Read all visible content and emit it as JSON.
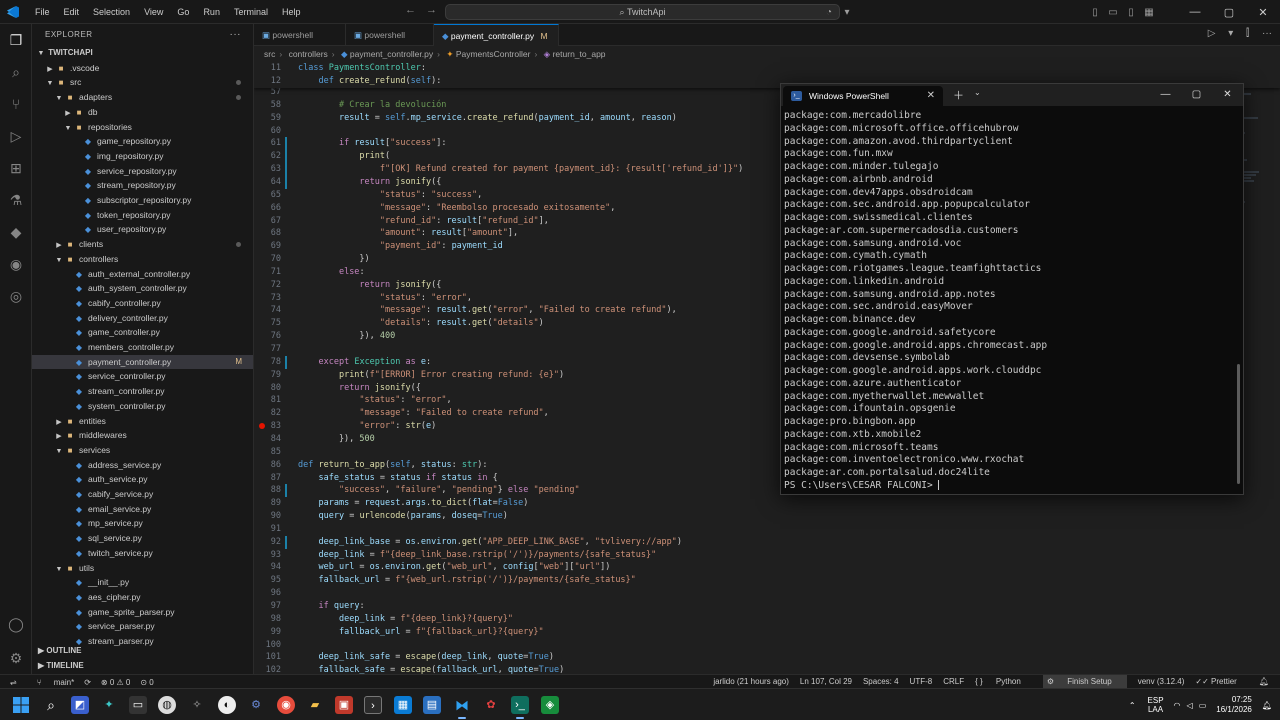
{
  "titlebar": {
    "menu": [
      "File",
      "Edit",
      "Selection",
      "View",
      "Go",
      "Run",
      "Terminal",
      "Help"
    ],
    "search": "TwitchApi"
  },
  "explorer": {
    "header": "EXPLORER",
    "root": "TWITCHAPI",
    "tree": [
      {
        "label": ".vscode",
        "depth": 1,
        "type": "folder",
        "open": false
      },
      {
        "label": "src",
        "depth": 1,
        "type": "folder",
        "open": true
      },
      {
        "label": "adapters",
        "depth": 2,
        "type": "folder",
        "open": true
      },
      {
        "label": "db",
        "depth": 3,
        "type": "folder",
        "open": false
      },
      {
        "label": "repositories",
        "depth": 3,
        "type": "folder",
        "open": true
      },
      {
        "label": "game_repository.py",
        "depth": 4,
        "type": "py"
      },
      {
        "label": "img_repository.py",
        "depth": 4,
        "type": "py"
      },
      {
        "label": "service_repository.py",
        "depth": 4,
        "type": "py"
      },
      {
        "label": "stream_repository.py",
        "depth": 4,
        "type": "py"
      },
      {
        "label": "subscriptor_repository.py",
        "depth": 4,
        "type": "py"
      },
      {
        "label": "token_repository.py",
        "depth": 4,
        "type": "py"
      },
      {
        "label": "user_repository.py",
        "depth": 4,
        "type": "py"
      },
      {
        "label": "clients",
        "depth": 2,
        "type": "folder",
        "open": false
      },
      {
        "label": "controllers",
        "depth": 2,
        "type": "folder",
        "open": true
      },
      {
        "label": "auth_external_controller.py",
        "depth": 3,
        "type": "py"
      },
      {
        "label": "auth_system_controller.py",
        "depth": 3,
        "type": "py"
      },
      {
        "label": "cabify_controller.py",
        "depth": 3,
        "type": "py"
      },
      {
        "label": "delivery_controller.py",
        "depth": 3,
        "type": "py"
      },
      {
        "label": "game_controller.py",
        "depth": 3,
        "type": "py"
      },
      {
        "label": "members_controller.py",
        "depth": 3,
        "type": "py"
      },
      {
        "label": "payment_controller.py",
        "depth": 3,
        "type": "py",
        "selected": true,
        "badge": "M"
      },
      {
        "label": "service_controller.py",
        "depth": 3,
        "type": "py"
      },
      {
        "label": "stream_controller.py",
        "depth": 3,
        "type": "py"
      },
      {
        "label": "system_controller.py",
        "depth": 3,
        "type": "py"
      },
      {
        "label": "entities",
        "depth": 2,
        "type": "folder",
        "open": false
      },
      {
        "label": "middlewares",
        "depth": 2,
        "type": "folder",
        "open": false
      },
      {
        "label": "services",
        "depth": 2,
        "type": "folder",
        "open": true
      },
      {
        "label": "address_service.py",
        "depth": 3,
        "type": "py"
      },
      {
        "label": "auth_service.py",
        "depth": 3,
        "type": "py"
      },
      {
        "label": "cabify_service.py",
        "depth": 3,
        "type": "py"
      },
      {
        "label": "email_service.py",
        "depth": 3,
        "type": "py"
      },
      {
        "label": "mp_service.py",
        "depth": 3,
        "type": "py"
      },
      {
        "label": "sql_service.py",
        "depth": 3,
        "type": "py"
      },
      {
        "label": "twitch_service.py",
        "depth": 3,
        "type": "py"
      },
      {
        "label": "utils",
        "depth": 2,
        "type": "folder",
        "open": true
      },
      {
        "label": "__init__.py",
        "depth": 3,
        "type": "py"
      },
      {
        "label": "aes_cipher.py",
        "depth": 3,
        "type": "py"
      },
      {
        "label": "game_sprite_parser.py",
        "depth": 3,
        "type": "py"
      },
      {
        "label": "service_parser.py",
        "depth": 3,
        "type": "py"
      },
      {
        "label": "stream_parser.py",
        "depth": 3,
        "type": "py"
      }
    ],
    "outline": "OUTLINE",
    "timeline": "TIMELINE"
  },
  "tabs": [
    {
      "label": "powershell",
      "active": false
    },
    {
      "label": "powershell",
      "active": false
    },
    {
      "label": "payment_controller.py",
      "active": true,
      "badge": "M"
    }
  ],
  "breadcrumb": [
    "src",
    "controllers",
    "payment_controller.py",
    "PaymentsController",
    "return_to_app"
  ],
  "code": {
    "sticky": [
      {
        "n": "11",
        "t": "class PaymentsController:"
      },
      {
        "n": "12",
        "t": "    def create_refund(self):"
      }
    ],
    "lines": [
      {
        "n": "57",
        "t": ""
      },
      {
        "n": "58",
        "t": "        # Crear la devolución"
      },
      {
        "n": "59",
        "t": "        result = self.mp_service.create_refund(payment_id, amount, reason)"
      },
      {
        "n": "60",
        "t": ""
      },
      {
        "n": "61",
        "t": "        if result[\"success\"]:"
      },
      {
        "n": "62",
        "t": "            print("
      },
      {
        "n": "63",
        "t": "                f\"[OK] Refund created for payment {payment_id}: {result['refund_id']}\")"
      },
      {
        "n": "64",
        "t": "            return jsonify({"
      },
      {
        "n": "65",
        "t": "                \"status\": \"success\","
      },
      {
        "n": "66",
        "t": "                \"message\": \"Reembolso procesado exitosamente\","
      },
      {
        "n": "67",
        "t": "                \"refund_id\": result[\"refund_id\"],"
      },
      {
        "n": "68",
        "t": "                \"amount\": result[\"amount\"],"
      },
      {
        "n": "69",
        "t": "                \"payment_id\": payment_id"
      },
      {
        "n": "70",
        "t": "            })"
      },
      {
        "n": "71",
        "t": "        else:"
      },
      {
        "n": "72",
        "t": "            return jsonify({"
      },
      {
        "n": "73",
        "t": "                \"status\": \"error\","
      },
      {
        "n": "74",
        "t": "                \"message\": result.get(\"error\", \"Failed to create refund\"),"
      },
      {
        "n": "75",
        "t": "                \"details\": result.get(\"details\")"
      },
      {
        "n": "76",
        "t": "            }), 400"
      },
      {
        "n": "77",
        "t": ""
      },
      {
        "n": "78",
        "t": "    except Exception as e:"
      },
      {
        "n": "79",
        "t": "        print(f\"[ERROR] Error creating refund: {e}\")"
      },
      {
        "n": "80",
        "t": "        return jsonify({"
      },
      {
        "n": "81",
        "t": "            \"status\": \"error\","
      },
      {
        "n": "82",
        "t": "            \"message\": \"Failed to create refund\","
      },
      {
        "n": "83",
        "t": "            \"error\": str(e)"
      },
      {
        "n": "84",
        "t": "        }), 500"
      },
      {
        "n": "85",
        "t": ""
      },
      {
        "n": "86",
        "t": "def return_to_app(self, status: str):"
      },
      {
        "n": "87",
        "t": "    safe_status = status if status in {"
      },
      {
        "n": "88",
        "t": "        \"success\", \"failure\", \"pending\"} else \"pending\""
      },
      {
        "n": "89",
        "t": "    params = request.args.to_dict(flat=False)"
      },
      {
        "n": "90",
        "t": "    query = urlencode(params, doseq=True)"
      },
      {
        "n": "91",
        "t": ""
      },
      {
        "n": "92",
        "t": "    deep_link_base = os.environ.get(\"APP_DEEP_LINK_BASE\", \"tvlivery://app\")"
      },
      {
        "n": "93",
        "t": "    deep_link = f\"{deep_link_base.rstrip('/')}/payments/{safe_status}\""
      },
      {
        "n": "94",
        "t": "    web_url = os.environ.get(\"web_url\", config[\"web\"][\"url\"])"
      },
      {
        "n": "95",
        "t": "    fallback_url = f\"{web_url.rstrip('/')}/payments/{safe_status}\""
      },
      {
        "n": "96",
        "t": ""
      },
      {
        "n": "97",
        "t": "    if query:"
      },
      {
        "n": "98",
        "t": "        deep_link = f\"{deep_link}?{query}\""
      },
      {
        "n": "99",
        "t": "        fallback_url = f\"{fallback_url}?{query}\""
      },
      {
        "n": "100",
        "t": ""
      },
      {
        "n": "101",
        "t": "    deep_link_safe = escape(deep_link, quote=True)"
      },
      {
        "n": "102",
        "t": "    fallback_safe = escape(fallback_url, quote=True)"
      }
    ]
  },
  "powershell": {
    "title": "Windows PowerShell",
    "lines": [
      "package:com.mercadolibre",
      "package:com.microsoft.office.officehubrow",
      "package:com.amazon.avod.thirdpartyclient",
      "package:com.fun.mxw",
      "package:com.minder.tulegajo",
      "package:com.airbnb.android",
      "package:com.dev47apps.obsdroidcam",
      "package:com.sec.android.app.popupcalculator",
      "package:com.swissmedical.clientes",
      "package:ar.com.supermercadosdia.customers",
      "package:com.samsung.android.voc",
      "package:com.cymath.cymath",
      "package:com.riotgames.league.teamfighttactics",
      "package:com.linkedin.android",
      "package:com.samsung.android.app.notes",
      "package:com.sec.android.easyMover",
      "package:com.binance.dev",
      "package:com.google.android.safetycore",
      "package:com.google.android.apps.chromecast.app",
      "package:com.devsense.symbolab",
      "package:com.google.android.apps.work.clouddpc",
      "package:com.azure.authenticator",
      "package:com.myetherwallet.mewwallet",
      "package:com.ifountain.opsgenie",
      "package:pro.bingbon.app",
      "package:com.xtb.xmobile2",
      "package:com.microsoft.teams",
      "package:com.inventoelectronico.www.rxochat",
      "package:ar.com.portalsalud.doc24lite"
    ],
    "prompt": "PS C:\\Users\\CESAR FALCONI> "
  },
  "statusbar": {
    "branch": "main*",
    "problems": "⊗ 0 ⚠ 0",
    "ports": "⊙ 0",
    "blame": "jarlido (21 hours ago)",
    "position": "Ln 107, Col 29",
    "spaces": "Spaces: 4",
    "encoding": "UTF-8",
    "eol": "CRLF",
    "language": "Python",
    "finish_setup": "Finish Setup",
    "venv": "venv (3.12.4)",
    "prettier": "Prettier"
  },
  "taskbar": {
    "lang_top": "ESP",
    "lang_bottom": "LAA",
    "time": "07:25",
    "date": "16/1/2026"
  }
}
